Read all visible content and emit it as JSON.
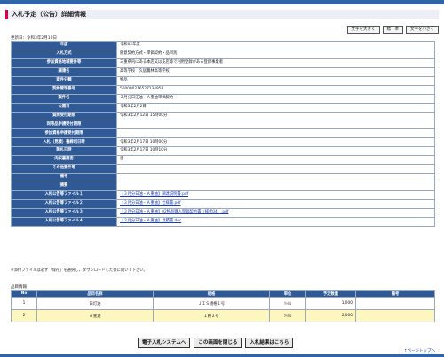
{
  "page_title": "入札予定（公告）詳細情報",
  "text_size": {
    "large": "文字を大きく",
    "standard": "標　準",
    "small": "文字を小さく"
  },
  "updated": "更新日：令和3年2月10日",
  "details": [
    {
      "label": "年度",
      "value": "令和02年度"
    },
    {
      "label": "入札方式",
      "value": "随意契約方式・単価契約・品目別"
    },
    {
      "label": "参加資格地域要件等",
      "value": "三重県内にある本店又は支店等で利用登録がある登録事業者"
    },
    {
      "label": "調達名",
      "value": "高等学校　久居農林高等学校"
    },
    {
      "label": "案件分類",
      "value": "物品"
    },
    {
      "label": "契約管理番号",
      "value": "500000216527134958"
    },
    {
      "label": "案件名",
      "value": "３月分日江油・Ａ重油単価契約"
    },
    {
      "label": "公開日",
      "value": "令和3年2月2日"
    },
    {
      "label": "質問受付期限",
      "value": "令和3年2月12日 15時00分"
    },
    {
      "label": "同等品申請受付期限",
      "value": ""
    },
    {
      "label": "参加資格申請受付期限",
      "value": ""
    },
    {
      "label": "入札（見積）書締切日時",
      "value": "令和3年2月17日 10時00分"
    },
    {
      "label": "開札日時",
      "value": "令和3年2月17日 10時10分"
    },
    {
      "label": "内訳書要否",
      "value": "否"
    },
    {
      "label": "その他要件等",
      "value": ""
    },
    {
      "label": "備考",
      "value": ""
    },
    {
      "label": "摘要",
      "value": ""
    }
  ],
  "files": [
    {
      "label": "入札公告等ファイル１",
      "link": "【３月分日油・Ａ重油】調達説明書.pdf"
    },
    {
      "label": "入札公告等ファイル２",
      "link": "【３月分日油・Ａ重油】仕様書.pdf"
    },
    {
      "label": "入札公告等ファイル３",
      "link": "【３月分日油・Ａ重油】02物品購入単価契約書（様式04）.pdf"
    },
    {
      "label": "入札公告等ファイル４",
      "link": "【３月分日油・Ａ重油】見積書.doc"
    }
  ],
  "note": "※添付ファイルは必ず「保存」を選択し、ダウンロードした後に開いて下さい。",
  "items_heading": "品目情報",
  "items_headers": {
    "no": "No",
    "name": "品目名称",
    "spec": "規格",
    "unit": "単位",
    "qty": "予定数量",
    "remarks": "備考"
  },
  "items": [
    {
      "no": "1",
      "name": "白灯油",
      "spec": "ＪＩＳ規格１号",
      "unit": "ﾘｯﾄﾙ",
      "qty": "1,000",
      "remarks": ""
    },
    {
      "no": "2",
      "name": "Ａ重油",
      "spec": "１種２号",
      "unit": "ﾘｯﾄﾙ",
      "qty": "2,000",
      "remarks": ""
    }
  ],
  "buttons": {
    "system": "電子入札システムへ",
    "close": "この画面を閉じる",
    "results": "入札結果はこちら"
  },
  "page_top": "↑ページトップへ"
}
